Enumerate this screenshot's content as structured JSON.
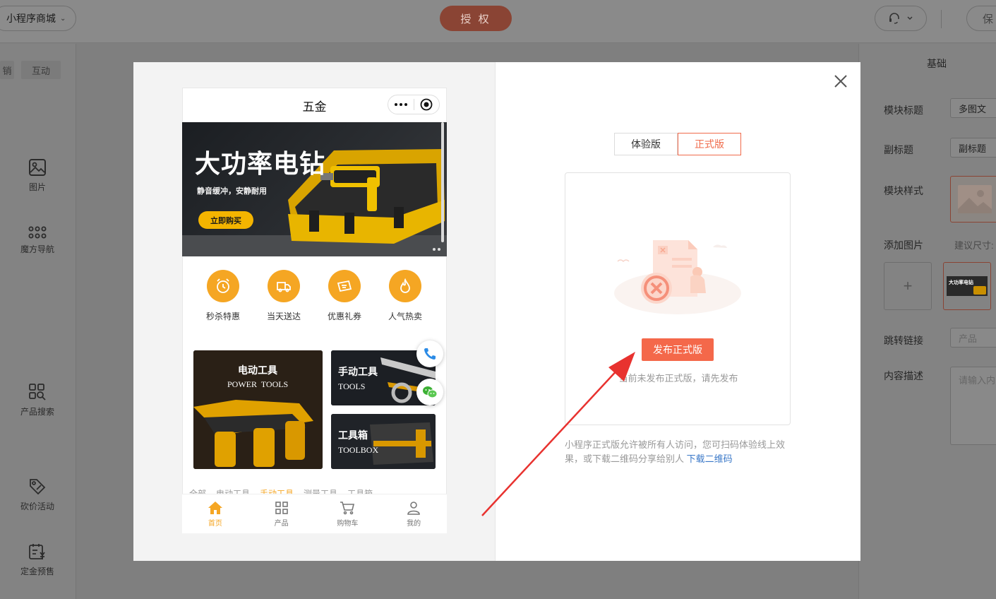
{
  "topbar": {
    "app_name": "小程序商城",
    "authorize_label": "授 权",
    "save_label": "保"
  },
  "sidebar": {
    "tabs": [
      "销",
      "互动"
    ],
    "items": [
      {
        "label": "图片",
        "icon": "image-icon"
      },
      {
        "label": "魔方导航",
        "icon": "grid-dots-icon"
      },
      {
        "label": "产品搜索",
        "icon": "product-search-icon"
      },
      {
        "label": "砍价活动",
        "icon": "bargain-tag-icon"
      },
      {
        "label": "定金预售",
        "icon": "presale-calendar-icon"
      }
    ]
  },
  "right_panel": {
    "header": "基础",
    "module_title_label": "模块标题",
    "module_title_value": "多图文",
    "subtitle_label": "副标题",
    "subtitle_value": "副标题",
    "module_style_label": "模块样式",
    "add_image_label": "添加图片",
    "suggest_size_label": "建议尺寸:",
    "thumb_text": "大功率电钻",
    "jump_link_label": "跳转链接",
    "jump_link_placeholder": "产品",
    "content_desc_label": "内容描述",
    "content_desc_placeholder": "请输入内"
  },
  "phone": {
    "title": "五金",
    "banner": {
      "title": "大功率电钻",
      "subtitle": "静音缓冲，安静耐用",
      "button": "立即购买"
    },
    "cube_nav": [
      {
        "label": "秒杀特惠",
        "icon": "alarm-clock-icon"
      },
      {
        "label": "当天送达",
        "icon": "delivery-truck-icon"
      },
      {
        "label": "优惠礼券",
        "icon": "coupon-ticket-icon"
      },
      {
        "label": "人气热卖",
        "icon": "flame-icon"
      }
    ],
    "cards": [
      {
        "title": "电动工具",
        "en": "POWER  TOOLS"
      },
      {
        "title": "手动工具",
        "en": "TOOLS"
      },
      {
        "title": "工具箱",
        "en": "TOOLBOX"
      }
    ],
    "category_tabs": [
      "全部",
      "电动工具",
      "手动工具",
      "测量工具",
      "工具箱"
    ],
    "active_category": "手动工具",
    "tabbar": [
      {
        "label": "首页",
        "icon": "home-icon",
        "active": true
      },
      {
        "label": "产品",
        "icon": "grid-icon",
        "active": false
      },
      {
        "label": "购物车",
        "icon": "cart-icon",
        "active": false
      },
      {
        "label": "我的",
        "icon": "user-icon",
        "active": false
      }
    ]
  },
  "modal": {
    "version_tabs": [
      "体验版",
      "正式版"
    ],
    "active_version": "正式版",
    "publish_button": "发布正式版",
    "publish_tip": "当前未发布正式版，请先发布",
    "description": "小程序正式版允许被所有人访问，您可扫码体验线上效果，或下载二维码分享给别人",
    "download_link": "下载二维码"
  },
  "colors": {
    "accent_orange": "#f4684a",
    "theme_yellow": "#f5a623",
    "arrow_red": "#e8322f",
    "link_blue": "#3a78c8"
  }
}
